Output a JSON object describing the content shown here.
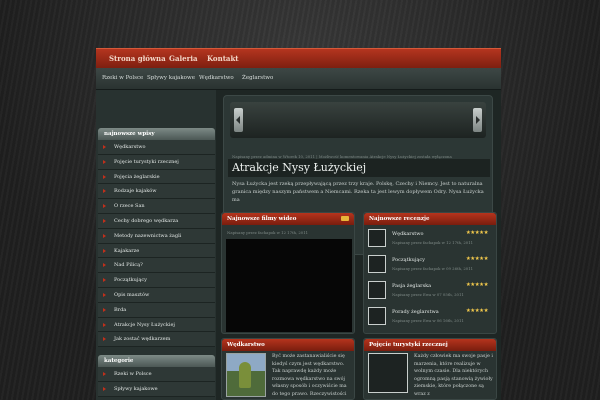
{
  "top_nav": [
    "Strona główna",
    "Galeria",
    "Kontakt"
  ],
  "sub_nav": [
    "Rzeki w Polsce",
    "Spływy kajakowe",
    "Wędkarstwo",
    "Żeglarstwo"
  ],
  "sidebar": {
    "latest_title": "najnowsze wpisy",
    "latest": [
      "Wędkarstwo",
      "Pojęcie turystyki rzecznej",
      "Pojęcia żeglarskie",
      "Rodzaje kajaków",
      "O rzece San",
      "Cechy dobrego wędkarza",
      "Metody nazewnictwa żagli",
      "Kajakarze",
      "Nad Pilicą?",
      "Początkujący",
      "Opis masztów",
      "Brda",
      "Atrakcje Nysy Łużyckiej",
      "Jak zostać wędkarzem"
    ],
    "categories_title": "kategorie",
    "categories": [
      "Rzeki w Polsce",
      "Spływy kajakowe"
    ]
  },
  "slider": {
    "meta": "Napisany przez admina w Wtorek 10, 2011 | Możliwość komentowania Atrakcje Nysy Łużyckiej została wyłączona",
    "title": "Atrakcje Nysy Łużyckiej",
    "text": "Nysa Łużycka jest rzeką przepływającą przez trzy kraje. Polskę, Czechy i Niemcy. Jest to naturalna granica między naszym państwem a Niemcami. Rzeka ta jest lewym dopływem Odry. Nysa Łużycka ma"
  },
  "videos": {
    "title": "Najnowsze filmy wideo",
    "meta": "Napisany przez fachapok w 12 17th, 2011"
  },
  "reviews": {
    "title": "Najnowsze recenzje",
    "items": [
      {
        "name": "Wędkarstwo",
        "stars": "★★★★★",
        "date": "Napisany przez fachapok w 12 17th, 2011"
      },
      {
        "name": "Początkujący",
        "stars": "★★★★★",
        "date": "Napisany przez fachapok w 09 26th, 2011"
      },
      {
        "name": "Pasja żeglarska",
        "stars": "★★★★★",
        "date": "Napisany przez Ewa w 07 05th, 2011"
      },
      {
        "name": "Porady żeglarstwa",
        "stars": "★★★★★",
        "date": "Napisany przez Ewa w 06 16th, 2011"
      }
    ]
  },
  "fishing": {
    "title": "Wędkarstwo",
    "text": "Być może zastanawialiście się kiedyś czym jest wędkarstwo. Tak naprawdę każdy może rozmowa wędkarstwo na swój własny sposób i oczywiście ma do tego prawo. Rzeczywistości"
  },
  "river_tourism": {
    "title": "Pojęcie turystyki rzecznej",
    "text": "Każdy człowiek ma swoje pasje i marzenia, które realizuje w wolnym czasie. Dla niektórych ogromną pasją stanowią żywioły ziemskie, które połączone są wraz z"
  }
}
